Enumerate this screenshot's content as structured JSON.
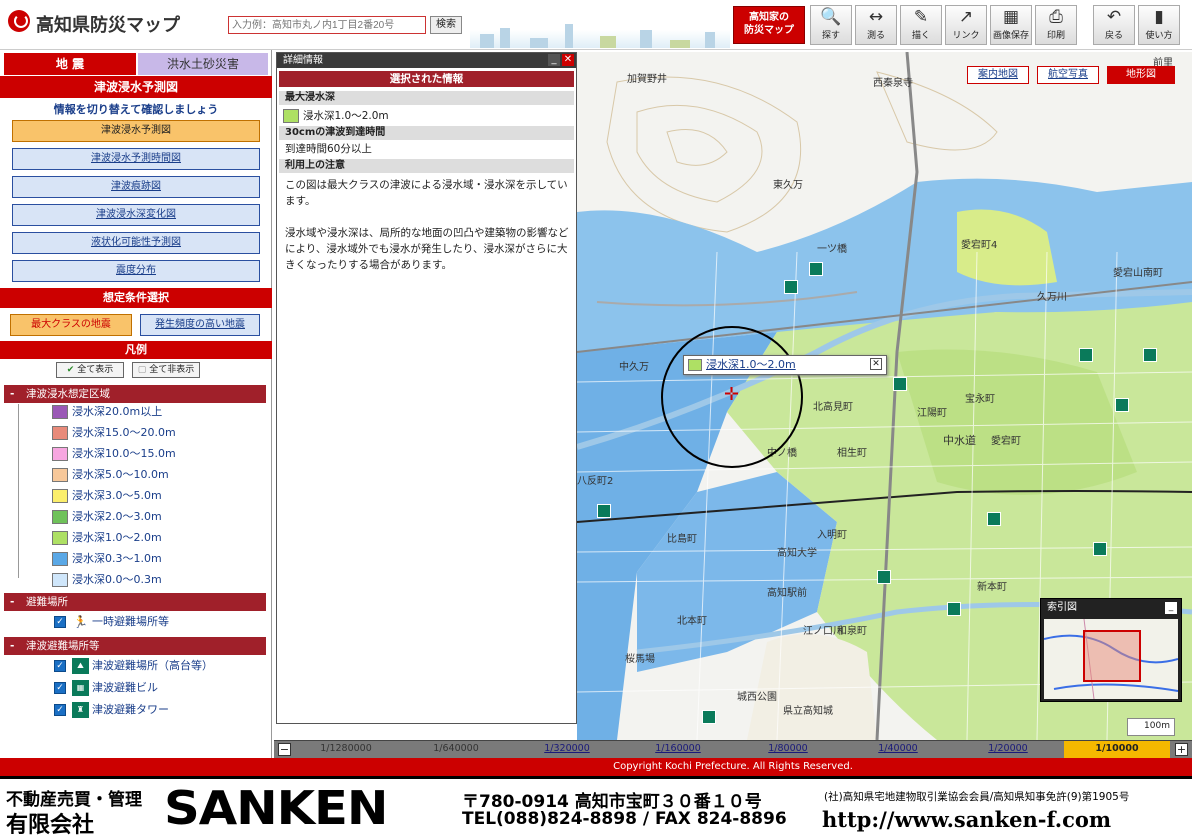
{
  "header": {
    "title": "高知県防災マップ",
    "search_placeholder": "入力例：高知市丸ノ内1丁目2番20号",
    "search_button": "検索",
    "bousai_button": "高知家の\n防災マップ",
    "tools": [
      {
        "label": "探す",
        "icon": "magnifier-icon"
      },
      {
        "label": "測る",
        "icon": "ruler-icon"
      },
      {
        "label": "描く",
        "icon": "draw-icon"
      },
      {
        "label": "リンク",
        "icon": "link-icon"
      },
      {
        "label": "画像保存",
        "icon": "image-save-icon"
      },
      {
        "label": "印刷",
        "icon": "printer-icon"
      },
      {
        "label": "戻る",
        "icon": "back-icon"
      },
      {
        "label": "使い方",
        "icon": "help-icon"
      }
    ]
  },
  "left": {
    "tab_earthquake": "地 震",
    "tab_flood": "洪水土砂災害",
    "section_title": "津波浸水予測図",
    "hint": "情報を切り替えて確認しましょう",
    "menu": [
      "津波浸水予測図",
      "津波浸水予測時間図",
      "津波痕跡図",
      "津波浸水深変化図",
      "液状化可能性予測図",
      "震度分布"
    ],
    "condition_title": "想定条件選択",
    "cond_max": "最大クラスの地震",
    "cond_high": "発生頻度の高い地震",
    "legend_title": "凡例",
    "show_all": "全て表示",
    "hide_all": "全て非表示",
    "group_tsunami": "津波浸水想定区域",
    "depth_items": [
      {
        "label": "浸水深20.0m以上",
        "color": "#9b59b6"
      },
      {
        "label": "浸水深15.0～20.0m",
        "color": "#e88a7a"
      },
      {
        "label": "浸水深10.0～15.0m",
        "color": "#f7a6e0"
      },
      {
        "label": "浸水深5.0～10.0m",
        "color": "#f7c89a"
      },
      {
        "label": "浸水深3.0～5.0m",
        "color": "#fbee6b"
      },
      {
        "label": "浸水深2.0～3.0m",
        "color": "#6fc25a"
      },
      {
        "label": "浸水深1.0～2.0m",
        "color": "#aee064"
      },
      {
        "label": "浸水深0.3～1.0m",
        "color": "#5aa8e6"
      },
      {
        "label": "浸水深0.0～0.3m",
        "color": "#cfe6fa"
      }
    ],
    "group_evac": "避難場所",
    "evac_items": [
      "一時避難場所等"
    ],
    "group_tsunami_evac": "津波避難場所等",
    "tsunami_evac_items": [
      "津波避難場所（高台等）",
      "津波避難ビル",
      "津波避難タワー"
    ]
  },
  "detail": {
    "title": "詳細情報",
    "selected": "選択された情報",
    "h1": "最大浸水深",
    "v1": "浸水深1.0～2.0m",
    "h2": "30cmの津波到達時間",
    "v2": "到達時間60分以上",
    "h3": "利用上の注意",
    "desc": "この図は最大クラスの津波による浸水域・浸水深を示しています。\n\n浸水域や浸水深は、局所的な地面の凹凸や建築物の影響などにより、浸水域外でも浸水が発生したり、浸水深がさらに大きくなったりする場合があります。"
  },
  "map": {
    "tabs": [
      "案内地図",
      "航空写真",
      "地形図"
    ],
    "callout": "浸水深1.0～2.0m",
    "index_title": "索引図",
    "scale_label": "100m",
    "labels": [
      "加賀野井",
      "西秦泉寺",
      "東久万",
      "愛宕町4",
      "愛宕山南町",
      "久万川",
      "一ツ橋",
      "中久万",
      "北高見町",
      "中ノ橋",
      "江陽町",
      "八反町2",
      "比島町",
      "宝永町",
      "相生町",
      "愛宕町",
      "中水道",
      "北本町",
      "入明町",
      "桜馬場",
      "高知大学",
      "県立高知城",
      "城西公園",
      "江ノ口川",
      "高知駅前",
      "新本町",
      "前里",
      "和泉町"
    ]
  },
  "scales": [
    "1/1280000",
    "1/640000",
    "1/320000",
    "1/160000",
    "1/80000",
    "1/40000",
    "1/20000",
    "1/10000"
  ],
  "copyright": "Copyright Kochi Prefecture. All Rights Reserved.",
  "footer": {
    "line1": "不動産売買・管理",
    "line2": "有限会社",
    "brand": "SANKEN",
    "address": "〒780-0914  高知市宝町３０番１０号",
    "tel": "TEL(088)824-8898 / FAX 824-8896",
    "assoc": "(社)高知県宅地建物取引業協会会員/高知県知事免許(9)第1905号",
    "url": "http://www.sanken-f.com"
  }
}
